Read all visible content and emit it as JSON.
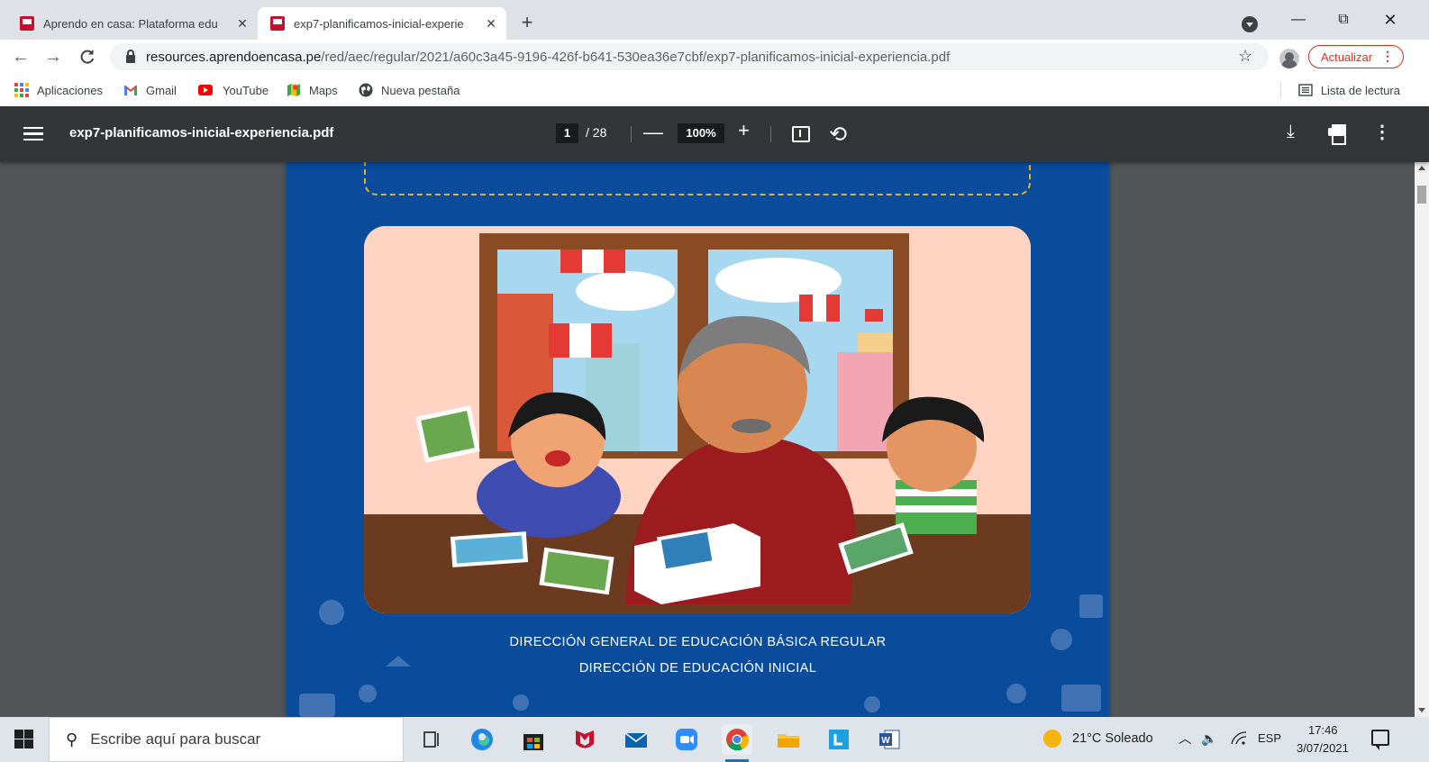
{
  "browser": {
    "tabs": [
      {
        "title": "Aprendo en casa: Plataforma edu",
        "close": "✕",
        "active": false
      },
      {
        "title": "exp7-planificamos-inicial-experie",
        "close": "✕",
        "active": true
      }
    ],
    "new_tab": "+",
    "window_controls": {
      "minimize": "—",
      "maximize": "⧉",
      "close": "✕"
    },
    "nav": {
      "back": "←",
      "forward": "→",
      "reload": "C"
    },
    "url_host": "resources.aprendoencasa.pe",
    "url_path": "/red/aec/regular/2021/a60c3a45-9196-426f-b641-530ea36e7cbf/exp7-planificamos-inicial-experiencia.pdf",
    "star": "☆",
    "update_label": "Actualizar",
    "update_menu": "⋮",
    "bookmarks": [
      "Aplicaciones",
      "Gmail",
      "YouTube",
      "Maps",
      "Nueva pestaña"
    ],
    "reading_list": "Lista de lectura"
  },
  "pdf_viewer": {
    "filename": "exp7-planificamos-inicial-experiencia.pdf",
    "current_page": "1",
    "total_pages": "/ 28",
    "zoom": "100%",
    "zoom_out": "—",
    "zoom_in": "+",
    "rotate": "⟲",
    "download": "⤓",
    "more": "⋮"
  },
  "document": {
    "credit_line_1": "DIRECCIÓN GENERAL DE EDUCACIÓN BÁSICA REGULAR",
    "credit_line_2": "DIRECCIÓN DE EDUCACIÓN INICIAL",
    "colors": {
      "page_background": "#0a4c9c",
      "dashed_border": "#e7b21f",
      "illustration_wall": "#ffd4c3",
      "table": "#6b3a1f"
    }
  },
  "taskbar": {
    "search_placeholder": "Escribe aquí para buscar",
    "search_icon": "⚲",
    "weather": "21°C  Soleado",
    "tray_chevron": "︿",
    "volume": "🔈",
    "language": "ESP",
    "time": "17:46",
    "date": "3/07/2021",
    "apps": [
      "task-view",
      "edge",
      "store",
      "mcafee",
      "mail",
      "zoom",
      "chrome",
      "file-explorer",
      "app-l",
      "word"
    ]
  }
}
